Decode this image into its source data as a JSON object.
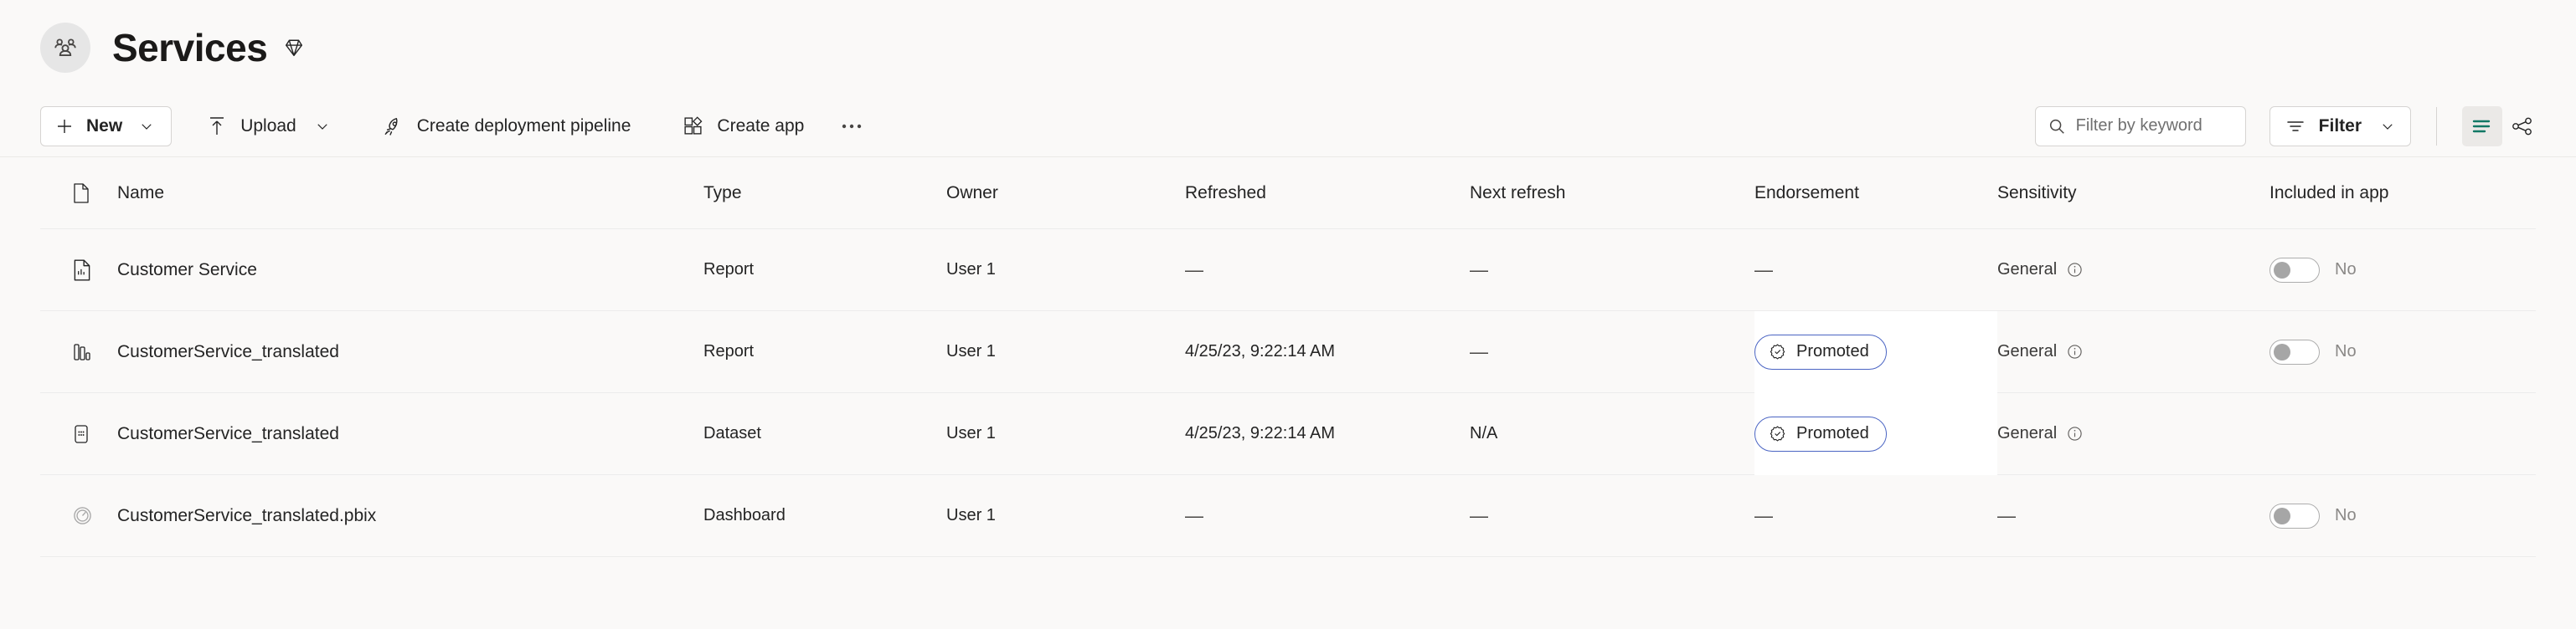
{
  "header": {
    "workspace_icon": "people-group-icon",
    "title": "Services",
    "premium_icon": "diamond-icon"
  },
  "toolbar": {
    "new_label": "New",
    "upload_label": "Upload",
    "create_pipeline_label": "Create deployment pipeline",
    "create_app_label": "Create app",
    "more_label": "•••",
    "search_placeholder": "Filter by keyword",
    "search_value": "",
    "filter_label": "Filter",
    "list_view_icon": "list-view-icon",
    "lineage_view_icon": "lineage-view-icon",
    "accent_color": "#117865"
  },
  "table": {
    "columns": [
      {
        "key": "icon",
        "label": ""
      },
      {
        "key": "name",
        "label": "Name"
      },
      {
        "key": "type",
        "label": "Type"
      },
      {
        "key": "owner",
        "label": "Owner"
      },
      {
        "key": "refreshed",
        "label": "Refreshed"
      },
      {
        "key": "next_refresh",
        "label": "Next refresh"
      },
      {
        "key": "endorsement",
        "label": "Endorsement"
      },
      {
        "key": "sensitivity",
        "label": "Sensitivity"
      },
      {
        "key": "included_in_app",
        "label": "Included in app"
      }
    ],
    "rows": [
      {
        "icon": "report-document-icon",
        "name": "Customer Service",
        "type": "Report",
        "owner": "User 1",
        "refreshed": "—",
        "next_refresh": "—",
        "endorsement": "—",
        "endorsement_badge": null,
        "sensitivity": "General",
        "has_sensitivity_info": true,
        "included_in_app": "No",
        "has_toggle": true,
        "toggle_on": false
      },
      {
        "icon": "report-bars-icon",
        "name": "CustomerService_translated",
        "type": "Report",
        "owner": "User 1",
        "refreshed": "4/25/23, 9:22:14 AM",
        "next_refresh": "—",
        "endorsement": "",
        "endorsement_badge": "Promoted",
        "sensitivity": "General",
        "has_sensitivity_info": true,
        "included_in_app": "No",
        "has_toggle": true,
        "toggle_on": false
      },
      {
        "icon": "dataset-icon",
        "name": "CustomerService_translated",
        "type": "Dataset",
        "owner": "User 1",
        "refreshed": "4/25/23, 9:22:14 AM",
        "next_refresh": "N/A",
        "endorsement": "",
        "endorsement_badge": "Promoted",
        "sensitivity": "General",
        "has_sensitivity_info": true,
        "included_in_app": "",
        "has_toggle": false,
        "toggle_on": false
      },
      {
        "icon": "dashboard-gauge-icon",
        "name": "CustomerService_translated.pbix",
        "type": "Dashboard",
        "owner": "User 1",
        "refreshed": "—",
        "next_refresh": "—",
        "endorsement": "—",
        "endorsement_badge": null,
        "sensitivity": "—",
        "has_sensitivity_info": false,
        "included_in_app": "No",
        "has_toggle": true,
        "toggle_on": false
      }
    ]
  }
}
